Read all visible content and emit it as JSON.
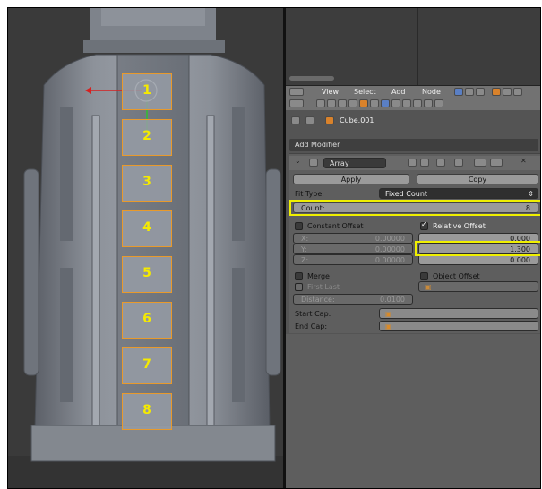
{
  "viewport": {
    "numbers": [
      "1",
      "2",
      "3",
      "4",
      "5",
      "6",
      "7",
      "8"
    ]
  },
  "header": {
    "menu": [
      "View",
      "Select",
      "Add",
      "Node"
    ]
  },
  "context": {
    "object_name": "Cube.001"
  },
  "modifier": {
    "add_modifier_label": "Add Modifier",
    "name": "Array",
    "apply_label": "Apply",
    "copy_label": "Copy",
    "fit_type_label": "Fit Type:",
    "fit_type_value": "Fixed Count",
    "count_label": "Count:",
    "count_value": "8",
    "constant_offset_label": "Constant Offset",
    "relative_offset_label": "Relative Offset",
    "constant": [
      {
        "axis": "X:",
        "value": "0.00000"
      },
      {
        "axis": "Y:",
        "value": "0.00000"
      },
      {
        "axis": "Z:",
        "value": "0.00000"
      }
    ],
    "relative": [
      "0.000",
      "1.300",
      "0.000"
    ],
    "merge_label": "Merge",
    "object_offset_label": "Object Offset",
    "first_last_label": "First Last",
    "distance_label": "Distance:",
    "distance_value": "0.0100",
    "start_cap_label": "Start Cap:",
    "end_cap_label": "End Cap:"
  },
  "colors": {
    "highlight": "#f0f000",
    "number": "#f5ea00",
    "selection": "#e89a2c"
  }
}
